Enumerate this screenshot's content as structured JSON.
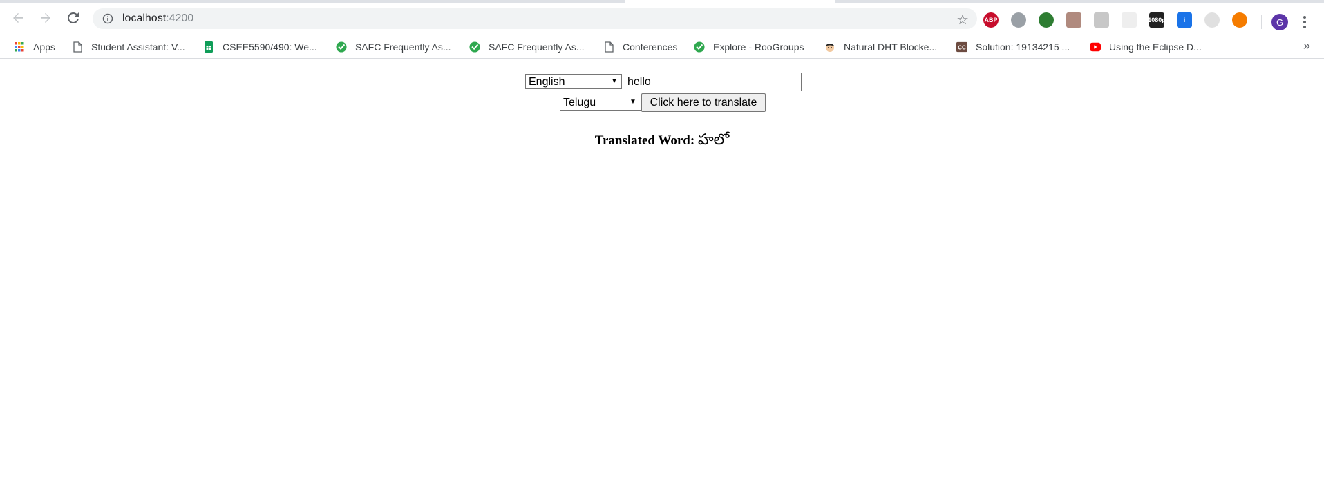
{
  "browser": {
    "url_host": "localhost",
    "url_port": ":4200",
    "profile_initial": "G",
    "extensions": [
      {
        "name": "adblock-plus-icon",
        "label": "ABP",
        "color": "#c70d2c"
      },
      {
        "name": "shield-extension-icon",
        "label": "",
        "color": "#9aa0a6"
      },
      {
        "name": "globe-extension-icon",
        "label": "",
        "color": "#2e7d32"
      },
      {
        "name": "pdf-extension-icon",
        "label": "",
        "color": "#b08a7e"
      },
      {
        "name": "grammar-extension-icon",
        "label": "",
        "color": "#c7c7c7"
      },
      {
        "name": "blank-extension-icon",
        "label": "",
        "color": "#eeeeee"
      },
      {
        "name": "video-extension-icon",
        "label": "1080p",
        "color": "#222222"
      },
      {
        "name": "info-extension-icon",
        "label": "i",
        "color": "#1a73e8"
      },
      {
        "name": "timer-extension-icon",
        "label": "",
        "color": "#e0e0e0"
      },
      {
        "name": "fire-extension-icon",
        "label": "",
        "color": "#f57c00"
      }
    ]
  },
  "bookmarks": [
    {
      "name": "bookmark-apps",
      "icon": "apps-grid-icon",
      "label": "Apps"
    },
    {
      "name": "bookmark-student-assistant",
      "icon": "page-icon",
      "label": "Student Assistant: V..."
    },
    {
      "name": "bookmark-csee5590",
      "icon": "sheets-icon",
      "label": "CSEE5590/490: We..."
    },
    {
      "name": "bookmark-safc-1",
      "icon": "check-badge-icon",
      "label": "SAFC Frequently As..."
    },
    {
      "name": "bookmark-safc-2",
      "icon": "check-badge-icon",
      "label": "SAFC Frequently As..."
    },
    {
      "name": "bookmark-conferences",
      "icon": "page-icon",
      "label": "Conferences"
    },
    {
      "name": "bookmark-explore-roogroups",
      "icon": "check-badge-icon",
      "label": "Explore - RooGroups"
    },
    {
      "name": "bookmark-natural-dht",
      "icon": "face-icon",
      "label": "Natural DHT Blocke..."
    },
    {
      "name": "bookmark-solution",
      "icon": "cc-icon",
      "label": "Solution: 19134215 ..."
    },
    {
      "name": "bookmark-eclipse",
      "icon": "youtube-icon",
      "label": "Using the Eclipse D..."
    }
  ],
  "translator": {
    "source_language": "English",
    "input_value": "hello",
    "target_language": "Telugu",
    "button_label": "Click here to translate",
    "result_label": "Translated Word:",
    "result_value": "హలో"
  }
}
